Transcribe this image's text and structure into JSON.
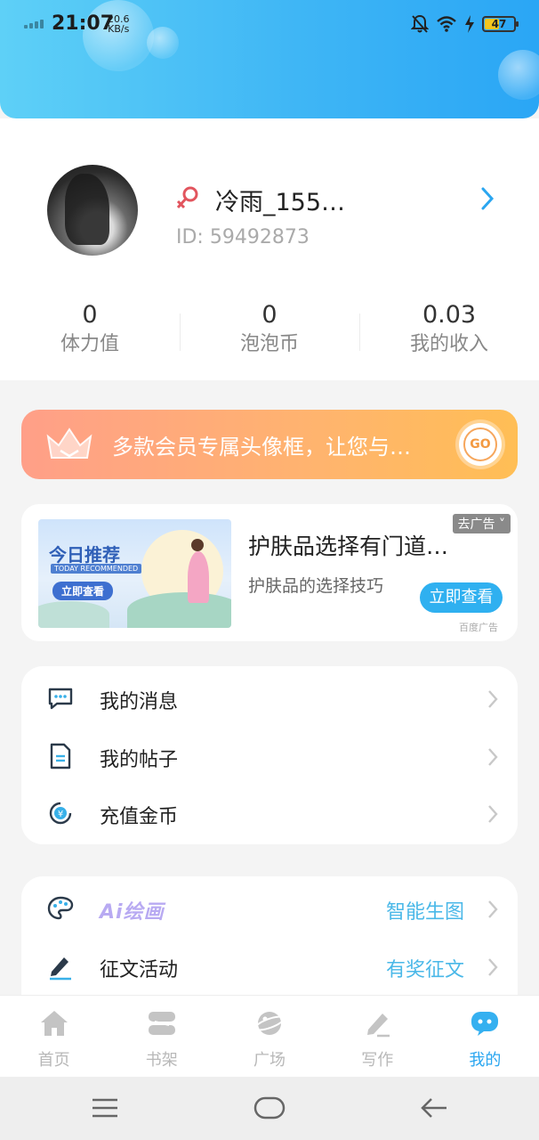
{
  "status_bar": {
    "time": "21:07",
    "net_speed_value": "20.6",
    "net_speed_unit": "KB/s",
    "battery": "47",
    "battery_level": 0.47
  },
  "profile": {
    "nickname": "冷雨_155…",
    "id_text": "ID:  59492873",
    "stats": [
      {
        "value": "0",
        "label": "体力值"
      },
      {
        "value": "0",
        "label": "泡泡币"
      },
      {
        "value": "0.03",
        "label": "我的收入"
      }
    ]
  },
  "vip_banner": {
    "text": "多款会员专属头像框，让您与…",
    "go_label": "GO"
  },
  "ad": {
    "image_title": "今日推荐",
    "image_subtitle": "TODAY RECOMMENDED",
    "image_button": "立即查看",
    "title": "护肤品选择有门道…",
    "description": "护肤品的选择技巧",
    "button": "立即查看",
    "close_label": "去广告 ˅",
    "source": "百度广告"
  },
  "menu_group_1": [
    {
      "label": "我的消息",
      "icon": "message-icon"
    },
    {
      "label": "我的帖子",
      "icon": "document-icon"
    },
    {
      "label": "充值金币",
      "icon": "yuan-coin-icon"
    }
  ],
  "menu_group_2": [
    {
      "label": "Ai绘画",
      "extra": "智能生图",
      "icon": "palette-icon"
    },
    {
      "label": "征文活动",
      "extra": "有奖征文",
      "icon": "pencil-icon"
    }
  ],
  "bottom_nav": [
    {
      "label": "首页",
      "icon": "home-icon"
    },
    {
      "label": "书架",
      "icon": "bookshelf-icon"
    },
    {
      "label": "广场",
      "icon": "planet-icon"
    },
    {
      "label": "写作",
      "icon": "write-icon"
    },
    {
      "label": "我的",
      "icon": "me-icon",
      "active": true
    }
  ],
  "colors": {
    "accent": "#2aa6f0",
    "header_start": "#5ed0f7",
    "header_end": "#2aa6f5",
    "vip_start": "#ff9f88",
    "vip_end": "#ffbe55"
  }
}
